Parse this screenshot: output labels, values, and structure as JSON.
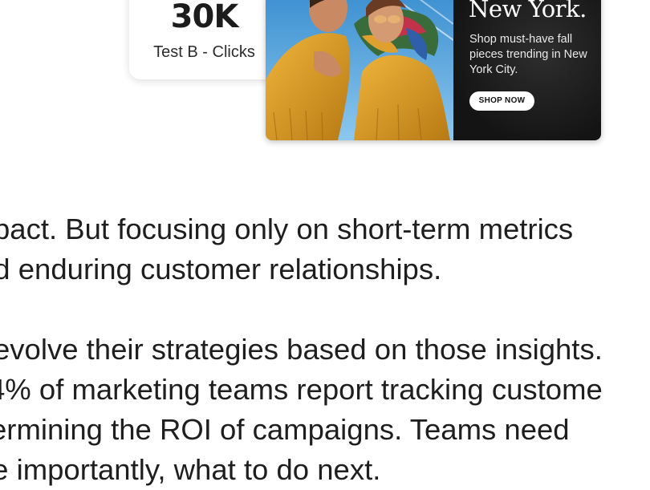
{
  "stat_card": {
    "value": "30K",
    "label": "Test B - Clicks"
  },
  "ad": {
    "headline": "New York.",
    "subtext": "Shop must-have fall pieces trending in New York City.",
    "cta": "SHOP NOW"
  },
  "article": {
    "lines": [
      "pact. But focusing only on short-term metrics",
      "nd enduring customer relationships.",
      "evolve their strategies based on those insights.",
      "4% of marketing teams report tracking custome",
      "ermining the ROI of campaigns. Teams need",
      "re importantly, what to do next."
    ]
  },
  "colors": {
    "card_bg": "#ffffff",
    "ad_panel": "#1c1c1c",
    "mustard": "#d99a24",
    "sky": "#5aa7d8"
  }
}
